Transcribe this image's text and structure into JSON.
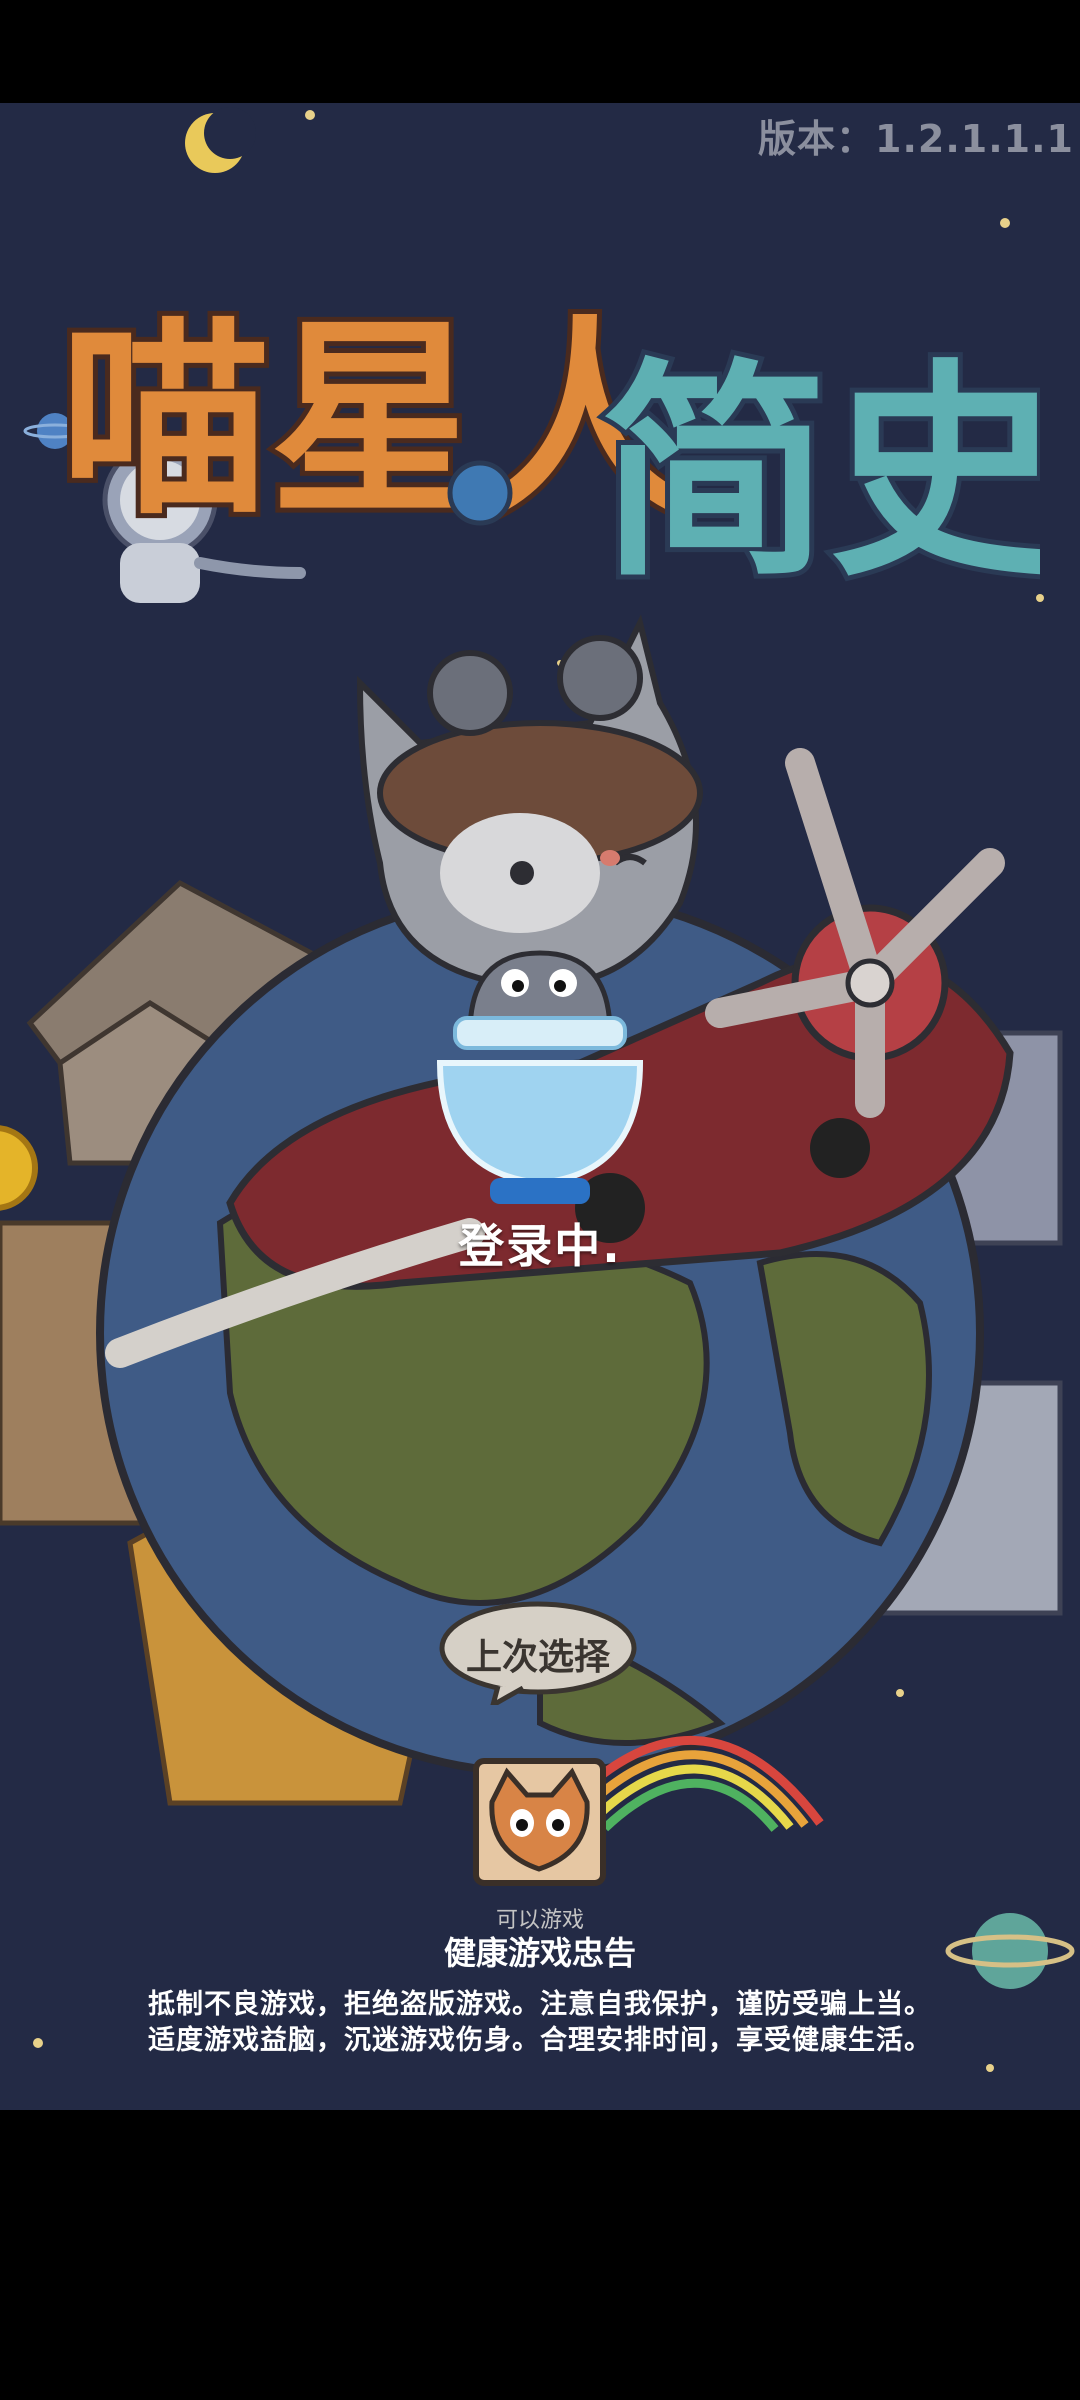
{
  "app": {
    "version_text": "版本：1.2.1.1.1",
    "title_text": "喵星人简史",
    "status_text": "登录中.",
    "last_choice_label": "上次选择",
    "can_play_label": "可以游戏"
  },
  "advisory": {
    "title": "健康游戏忠告",
    "line1": "抵制不良游戏，拒绝盗版游戏。注意自我保护，谨防受骗上当。",
    "line2": "适度游戏益脑，沉迷游戏伤身。合理安排时间，享受健康生活。"
  },
  "icons": [
    "moon-icon",
    "planet-icon",
    "astronaut-cat-icon",
    "cat-avatar-icon",
    "coin-icon"
  ],
  "colors": {
    "background": "#232a45",
    "ocean": "#3f5b86",
    "land": "#5e6b3a",
    "plane": "#7d2a2f"
  }
}
